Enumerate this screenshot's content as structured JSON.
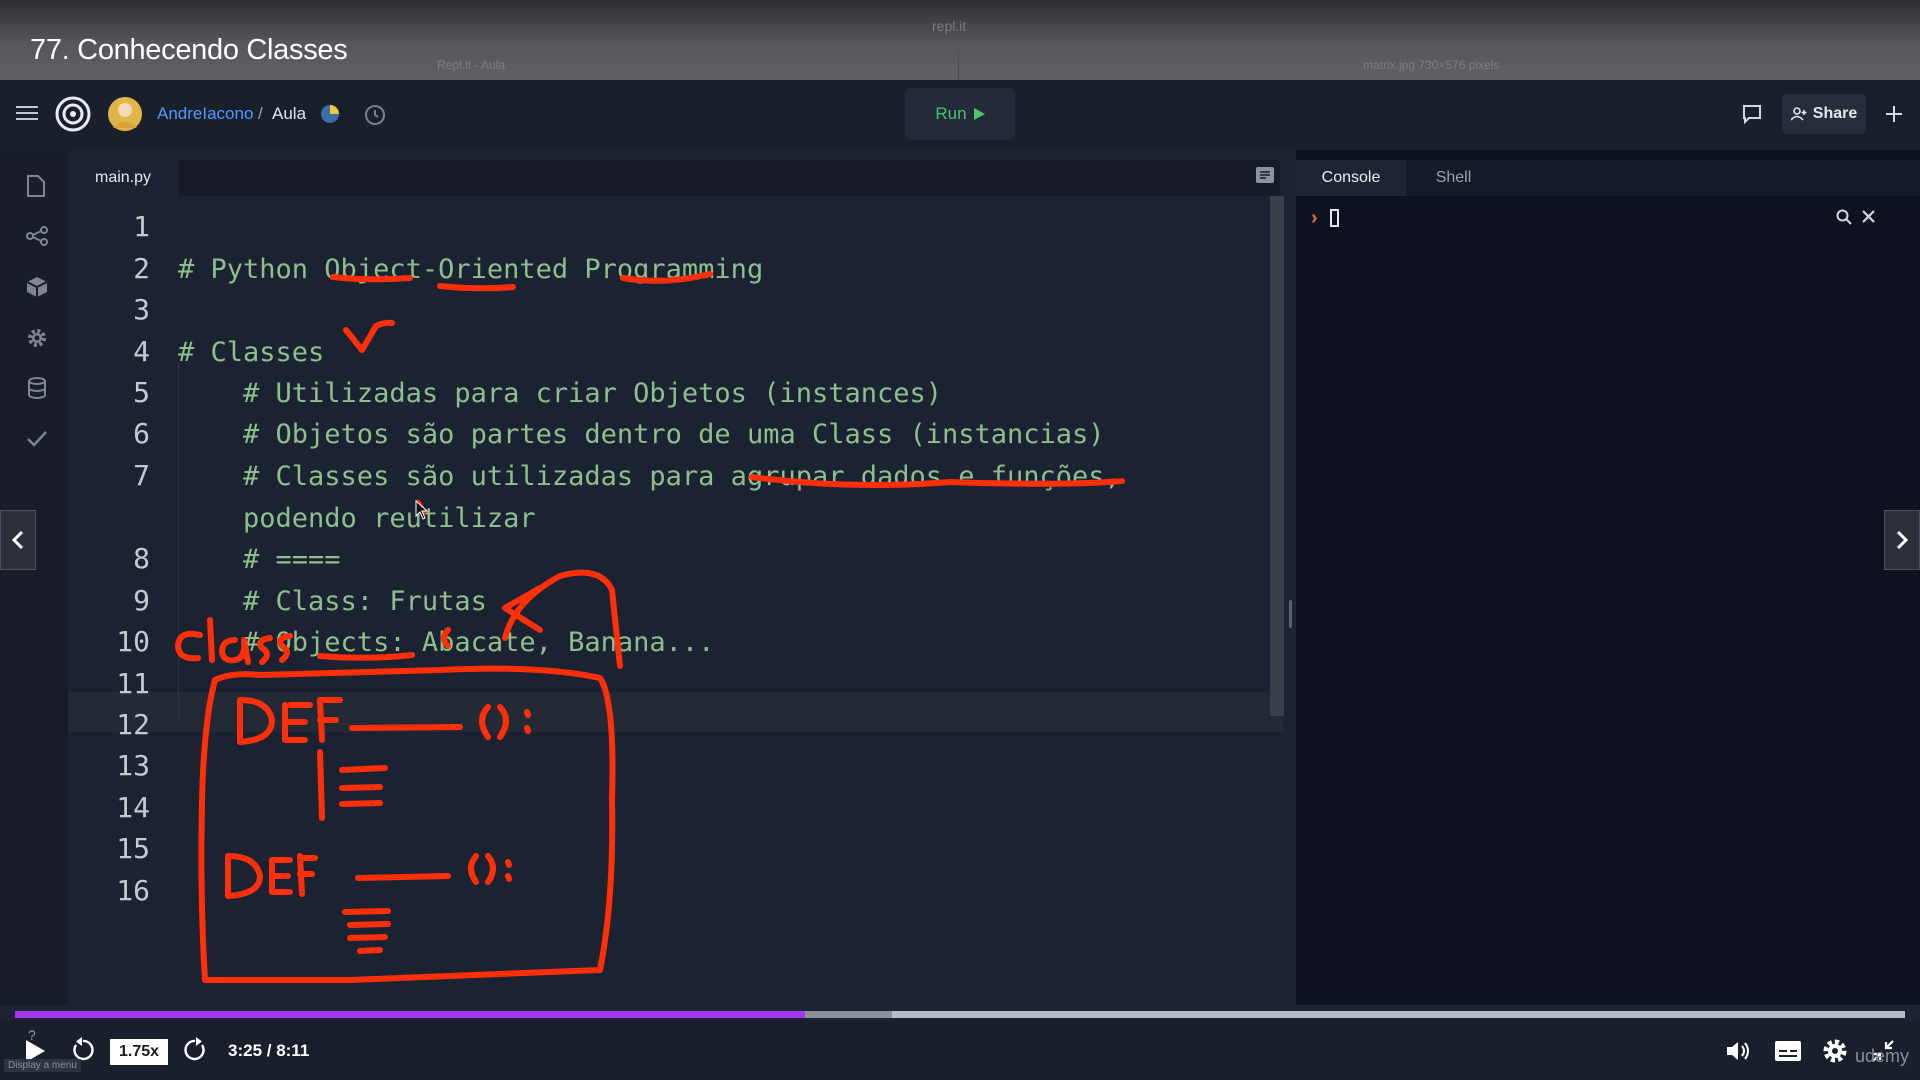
{
  "video": {
    "title": "77. Conhecendo Classes",
    "speed": "1.75x",
    "time": "3:25 / 8:11",
    "progress_fraction": 0.418,
    "buffered_fraction": 0.464,
    "watermark": "udemy",
    "tooltip": "Display a menu",
    "accent_color": "#a435f0"
  },
  "browser": {
    "url": "repl.it",
    "tab_left": "Repl.it - Aula",
    "tab_right": "matrix.jpg 730×576 pixels"
  },
  "header": {
    "user": "AndreIacono",
    "separator": "/",
    "repl_name": "Aula",
    "run_label": "Run",
    "share_label": "Share"
  },
  "editor": {
    "file_tab": "main.py",
    "current_line": "12",
    "line_numbers": [
      "1",
      "2",
      "3",
      "4",
      "5",
      "6",
      "7",
      "",
      "8",
      "9",
      "10",
      "11",
      "12",
      "13",
      "14",
      "15",
      "16"
    ],
    "lines": [
      "",
      "# Python Object-Oriented Programming",
      "",
      "# Classes",
      "    # Utilizadas para criar Objetos (instances)",
      "    # Objetos são partes dentro de uma Class (instancias)",
      "    # Classes são utilizadas para agrupar dados e funções,",
      "    podendo reutilizar",
      "    # ====",
      "    # Class: Frutas",
      "    # Objects: Abacate, Banana...",
      "",
      "",
      "",
      "",
      "",
      ""
    ]
  },
  "console": {
    "tab_console": "Console",
    "tab_shell": "Shell",
    "prompt": "›"
  },
  "sidebar_icons": [
    "files-icon",
    "version-control-icon",
    "packages-icon",
    "settings-icon",
    "database-icon",
    "check-icon"
  ],
  "annotation_color": "#ff2f0a"
}
